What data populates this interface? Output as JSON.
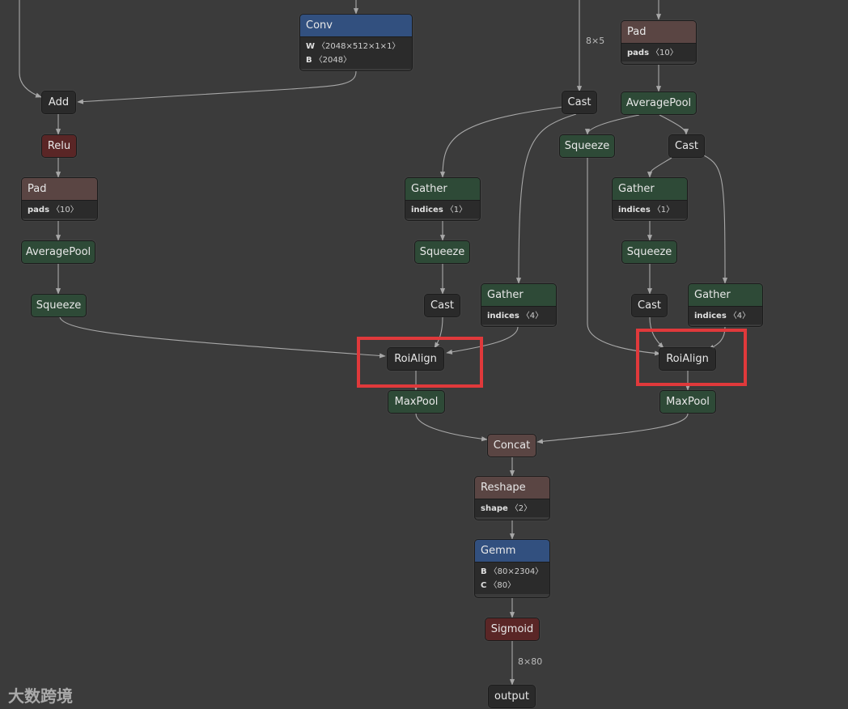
{
  "nodes": {
    "conv": {
      "label": "Conv",
      "attrs": [
        {
          "key": "W",
          "value": "〈2048×512×1×1〉"
        },
        {
          "key": "B",
          "value": "〈2048〉"
        }
      ]
    },
    "pad_right": {
      "label": "Pad",
      "attrs": [
        {
          "key": "pads",
          "value": "〈10〉"
        }
      ]
    },
    "add": {
      "label": "Add"
    },
    "cast_top": {
      "label": "Cast"
    },
    "avgpool_right": {
      "label": "AveragePool"
    },
    "relu": {
      "label": "Relu"
    },
    "squeeze_mid_right": {
      "label": "Squeeze"
    },
    "cast_right": {
      "label": "Cast"
    },
    "pad_left": {
      "label": "Pad",
      "attrs": [
        {
          "key": "pads",
          "value": "〈10〉"
        }
      ]
    },
    "gather_mid": {
      "label": "Gather",
      "attrs": [
        {
          "key": "indices",
          "value": "〈1〉"
        }
      ]
    },
    "gather_right": {
      "label": "Gather",
      "attrs": [
        {
          "key": "indices",
          "value": "〈1〉"
        }
      ]
    },
    "avgpool_left": {
      "label": "AveragePool"
    },
    "squeeze_mid": {
      "label": "Squeeze"
    },
    "squeeze_right": {
      "label": "Squeeze"
    },
    "gather4_mid": {
      "label": "Gather",
      "attrs": [
        {
          "key": "indices",
          "value": "〈4〉"
        }
      ]
    },
    "gather4_right": {
      "label": "Gather",
      "attrs": [
        {
          "key": "indices",
          "value": "〈4〉"
        }
      ]
    },
    "squeeze_left": {
      "label": "Squeeze"
    },
    "cast_mid": {
      "label": "Cast"
    },
    "cast_right2": {
      "label": "Cast"
    },
    "roialign_left": {
      "label": "RoiAlign"
    },
    "roialign_right": {
      "label": "RoiAlign"
    },
    "maxpool_left": {
      "label": "MaxPool"
    },
    "maxpool_right": {
      "label": "MaxPool"
    },
    "concat": {
      "label": "Concat"
    },
    "reshape": {
      "label": "Reshape",
      "attrs": [
        {
          "key": "shape",
          "value": "〈2〉"
        }
      ]
    },
    "gemm": {
      "label": "Gemm",
      "attrs": [
        {
          "key": "B",
          "value": "〈80×2304〉"
        },
        {
          "key": "C",
          "value": "〈80〉"
        }
      ]
    },
    "sigmoid": {
      "label": "Sigmoid"
    },
    "output": {
      "label": "output"
    }
  },
  "edge_labels": {
    "to_cast_top": "8×5",
    "to_output": "8×80"
  },
  "watermark": "大数跨境",
  "colors": {
    "background": "#3b3b3b",
    "edge": "#a8a8a8",
    "highlight": "#e0393b",
    "node_dark": "#2a2a2a",
    "node_green": "#2e4a37",
    "node_red": "#5a2626",
    "node_brown": "#5a4543",
    "node_blue": "#32507f"
  }
}
